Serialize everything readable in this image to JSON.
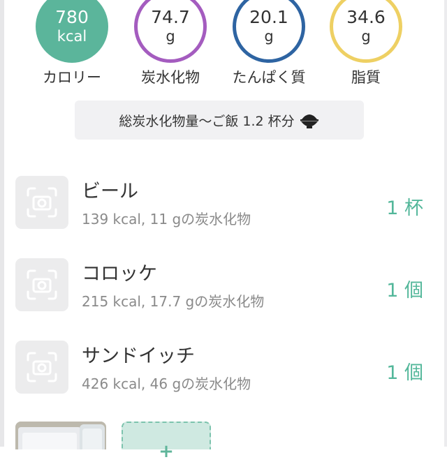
{
  "nutrients": [
    {
      "value": "780",
      "unit": "kcal",
      "label": "カロリー",
      "color": "#5bb59b",
      "filled": true
    },
    {
      "value": "74.7",
      "unit": "g",
      "label": "炭水化物",
      "color": "#a45cbf",
      "filled": false
    },
    {
      "value": "20.1",
      "unit": "g",
      "label": "たんぱく質",
      "color": "#2e64a2",
      "filled": false
    },
    {
      "value": "34.6",
      "unit": "g",
      "label": "脂質",
      "color": "#eed063",
      "filled": false
    }
  ],
  "carb_summary": {
    "text": "総炭水化物量〜ご飯 1.2 杯分",
    "icon": "rice-bowl-icon"
  },
  "foods": [
    {
      "name": "ビール",
      "meta": "139 kcal, 11 gの炭水化物",
      "quantity": "1 杯"
    },
    {
      "name": "コロッケ",
      "meta": "215 kcal, 17.7 gの炭水化物",
      "quantity": "1 個"
    },
    {
      "name": "サンドイッチ",
      "meta": "426 kcal, 46 gの炭水化物",
      "quantity": "1 個"
    }
  ],
  "colors": {
    "accent": "#53b79a",
    "pill_bg": "#f1f1f3",
    "add_bg": "#cfe9e1"
  },
  "add_button": {
    "icon": "plus-icon",
    "symbol": "+"
  }
}
